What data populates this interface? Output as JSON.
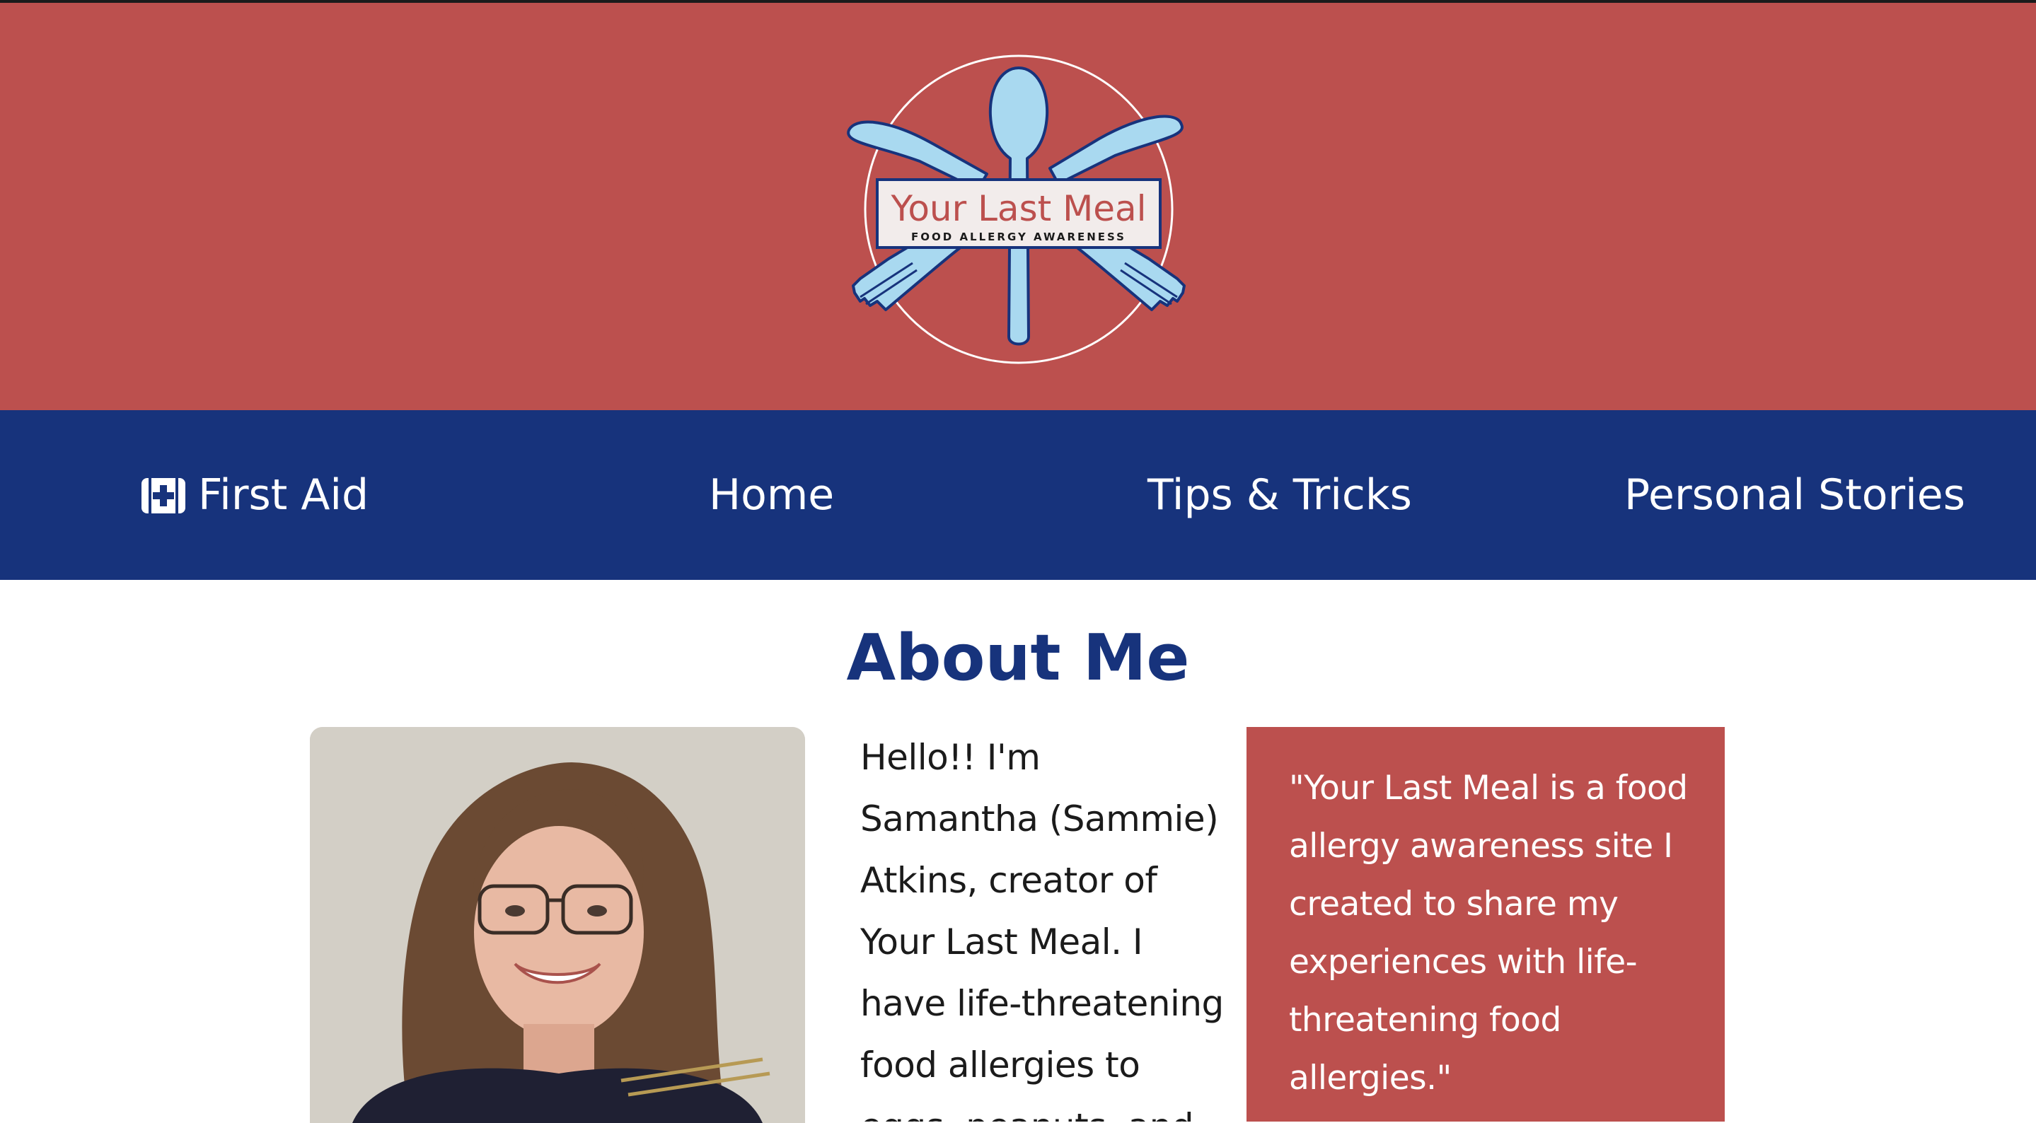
{
  "header": {
    "logo": {
      "title": "Your Last Meal",
      "subtitle": "FOOD ALLERGY AWARENESS"
    }
  },
  "nav": {
    "items": [
      {
        "label": "First Aid",
        "icon": "first-aid-kit-icon"
      },
      {
        "label": "Home"
      },
      {
        "label": "Tips & Tricks"
      },
      {
        "label": "Personal Stories"
      }
    ]
  },
  "main": {
    "title": "About Me",
    "intro": "Hello!! I'm Samantha (Sammie) Atkins, creator of Your Last Meal. I have life-threatening food allergies to eggs, peanuts, and",
    "quote": "\"Your Last Meal is a food allergy awareness site I created to share my experiences with life-threatening food allergies.\""
  },
  "colors": {
    "header_red": "#bc504e",
    "nav_blue": "#17337c",
    "title_blue": "#17337c",
    "utensil_blue": "#a9d9f0"
  }
}
